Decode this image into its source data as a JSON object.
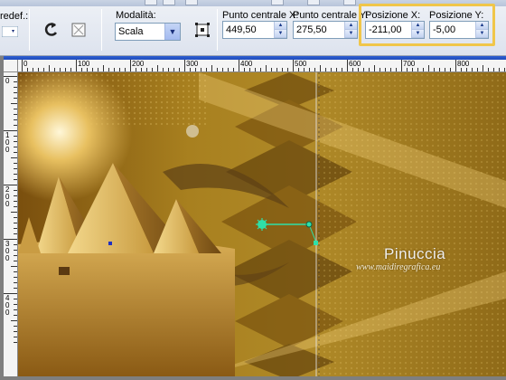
{
  "toolbar": {
    "preset_label": "redef.:",
    "mode_label": "Modalità:",
    "mode_value": "Scala",
    "center_x": {
      "label": "Punto centrale X:",
      "value": "449,50"
    },
    "center_y": {
      "label": "Punto centrale Y:",
      "value": "275,50"
    },
    "pos_x": {
      "label": "Posizione X:",
      "value": "-211,00"
    },
    "pos_y": {
      "label": "Posizione Y:",
      "value": "-5,00"
    },
    "highlight_color": "#f0c64a"
  },
  "ruler": {
    "h_labels": [
      "0",
      "100",
      "200",
      "300",
      "400",
      "500",
      "600",
      "700",
      "800"
    ],
    "v_labels": [
      "0",
      "100",
      "200",
      "300",
      "400"
    ]
  },
  "canvas": {
    "watermark_title": "Pinuccia",
    "watermark_url": "www.maidiregrafica.eu",
    "handle_color": "#2ee0a8"
  }
}
